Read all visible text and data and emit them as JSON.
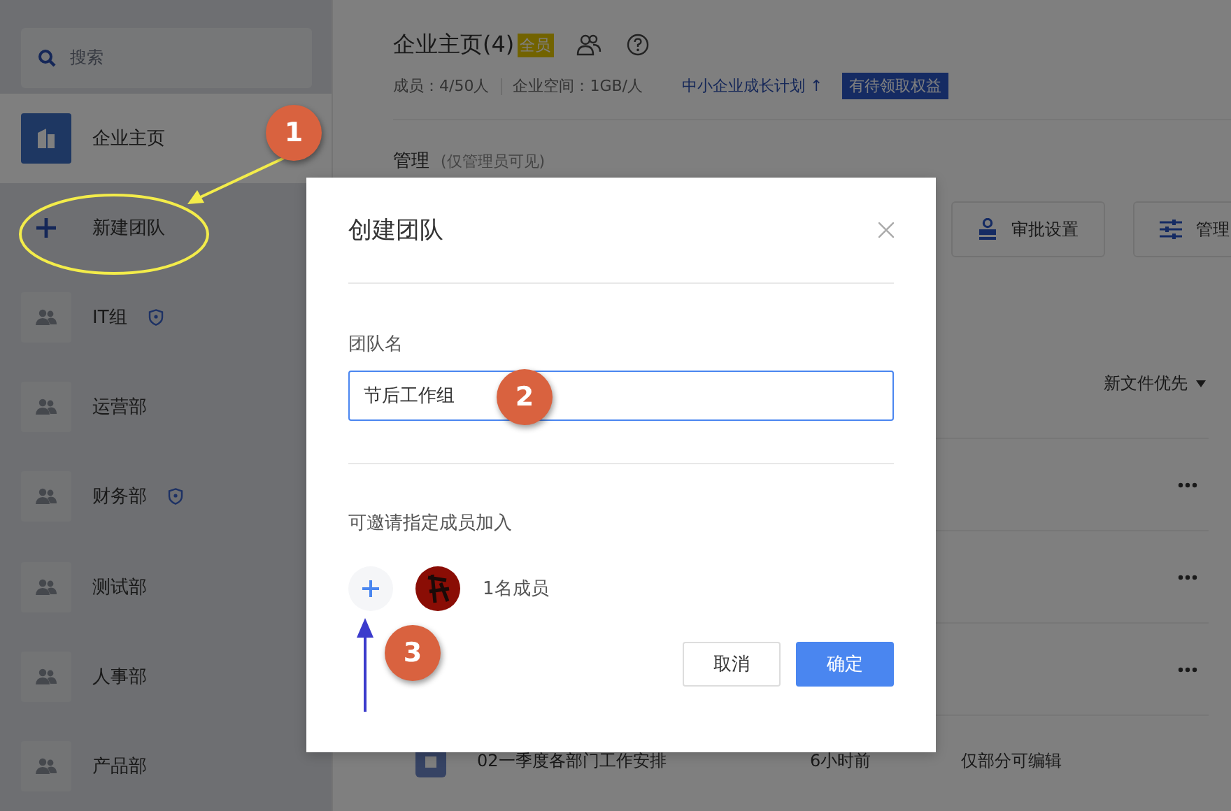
{
  "sidebar": {
    "search": {
      "placeholder": "搜索"
    },
    "items": [
      {
        "label": "企业主页",
        "kind": "home",
        "selected": true,
        "secure": false
      },
      {
        "label": "新建团队",
        "kind": "new",
        "selected": false,
        "secure": false
      },
      {
        "label": "IT组",
        "kind": "team",
        "selected": false,
        "secure": true
      },
      {
        "label": "运营部",
        "kind": "team",
        "selected": false,
        "secure": false
      },
      {
        "label": "财务部",
        "kind": "team",
        "selected": false,
        "secure": true
      },
      {
        "label": "测试部",
        "kind": "team",
        "selected": false,
        "secure": false
      },
      {
        "label": "人事部",
        "kind": "team",
        "selected": false,
        "secure": false
      },
      {
        "label": "产品部",
        "kind": "team",
        "selected": false,
        "secure": false
      }
    ]
  },
  "main": {
    "title": "企业主页(4)",
    "badge": "全员",
    "stats": [
      "成员：4/50人",
      "企业空间：1GB/人"
    ],
    "plan_link": "中小企业成长计划 ↑",
    "plan_tag": "有待领取权益",
    "section_title": "管理",
    "section_note": "(仅管理员可见)",
    "buttons": [
      {
        "label": "审批设置",
        "kind": "stamp"
      },
      {
        "label": "管理",
        "kind": "sliders"
      }
    ],
    "sort": "新文件优先",
    "rows": [
      {
        "menu": true
      },
      {
        "menu": true
      },
      {
        "menu": true
      },
      {
        "name": "02一季度各部门工作安排",
        "time": "6小时前",
        "access": "仅部分可编辑",
        "menu": false
      }
    ]
  },
  "dialog": {
    "title": "创建团队",
    "field_label": "团队名",
    "value": "节后工作组",
    "invite_label": "可邀请指定成员加入",
    "member_count": "1名成员",
    "buttons": [
      {
        "label": "取消",
        "kind": "secondary"
      },
      {
        "label": "确定",
        "kind": "primary"
      }
    ]
  },
  "annotations": [
    "1",
    "2",
    "3"
  ]
}
